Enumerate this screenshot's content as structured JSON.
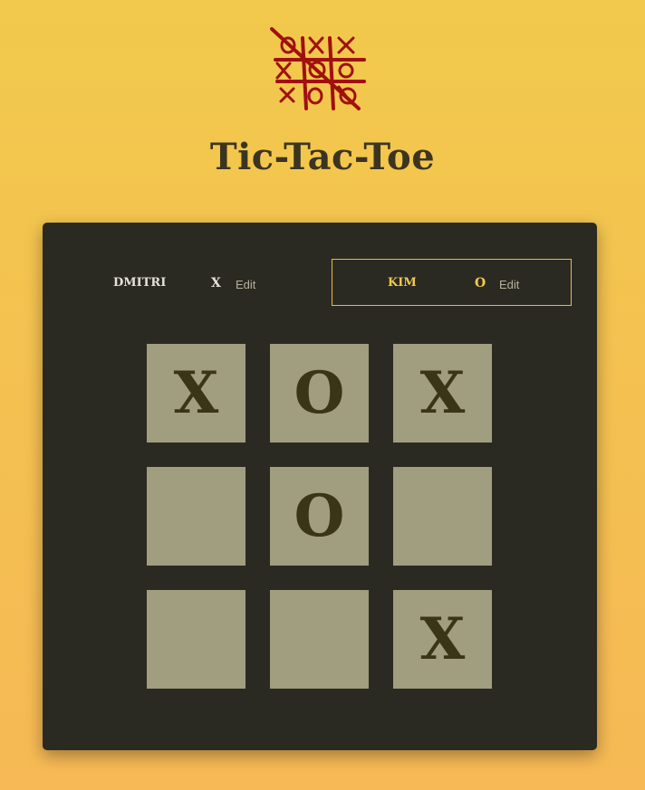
{
  "title": "Tic-Tac-Toe",
  "logo": {
    "icon": "tic-tac-toe-logo-icon",
    "color": "#a0100f"
  },
  "players": [
    {
      "name": "DMITRI",
      "symbol": "X",
      "edit_label": "Edit",
      "active": false
    },
    {
      "name": "KIM",
      "symbol": "O",
      "edit_label": "Edit",
      "active": true
    }
  ],
  "board": [
    "X",
    "O",
    "X",
    "",
    "O",
    "",
    "",
    "",
    "X"
  ],
  "colors": {
    "background": "#f2c94c",
    "panel": "#2b2a22",
    "cell": "#a19d7f",
    "mark": "#3b3518",
    "active_player": "#f3c94d"
  }
}
